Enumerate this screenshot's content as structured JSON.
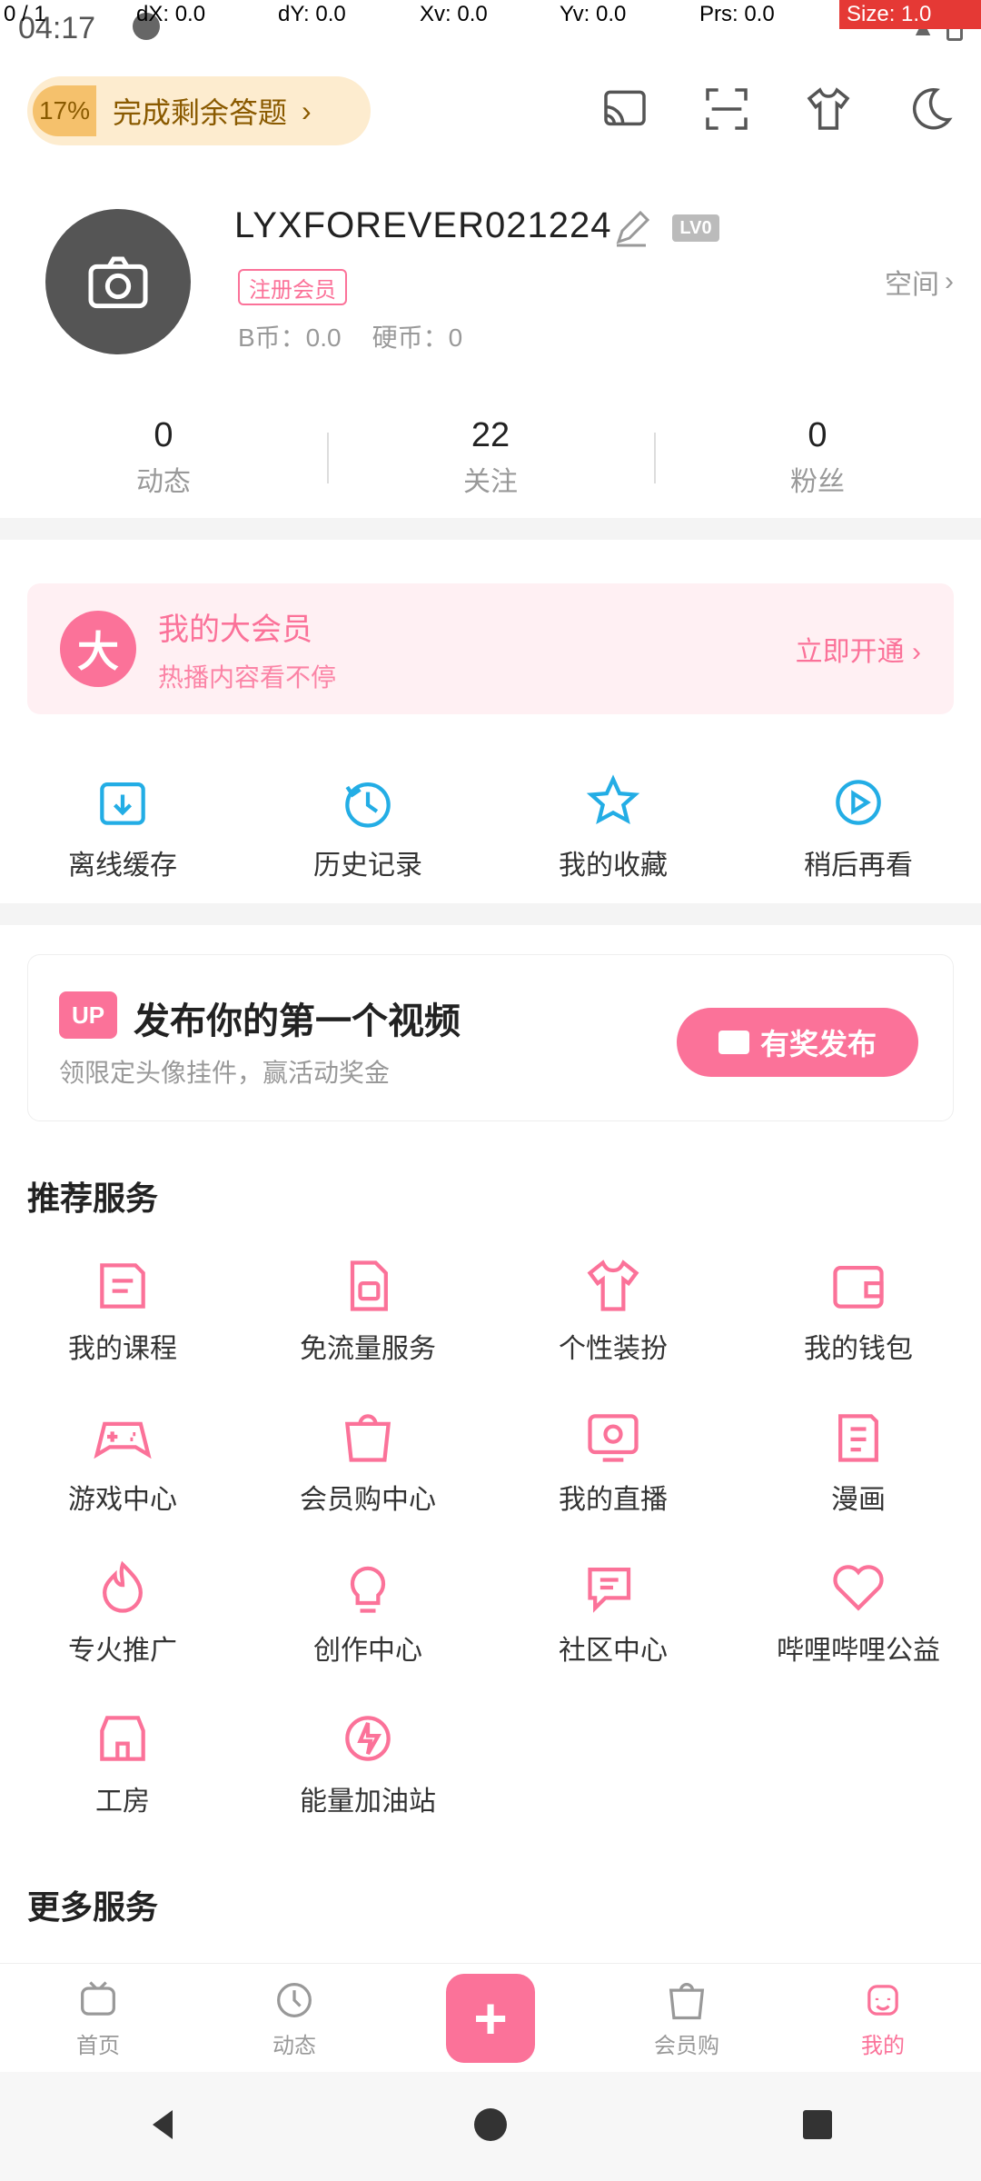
{
  "statusbar": {
    "time": "04:17"
  },
  "debug": {
    "p": "0 / 1",
    "dx": "dX: 0.0",
    "dy": "dY: 0.0",
    "xv": "Xv: 0.0",
    "yv": "Yv: 0.0",
    "prs": "Prs: 0.0",
    "size": "Size: 1.0"
  },
  "topbar": {
    "percent": "17%",
    "answers_text": "完成剩余答题",
    "answers_arrow": "›",
    "icons": [
      "cast-icon",
      "scan-icon",
      "tshirt-icon",
      "moon-icon"
    ]
  },
  "profile": {
    "username": "LYXFOREVER021224",
    "lv": "LV0",
    "register_tag": "注册会员",
    "space_link": "空间",
    "bcoin": "B币：0.0",
    "coin": "硬币：0"
  },
  "stats": [
    {
      "num": "0",
      "label": "动态"
    },
    {
      "num": "22",
      "label": "关注"
    },
    {
      "num": "0",
      "label": "粉丝"
    }
  ],
  "vip": {
    "badge": "大",
    "title": "我的大会员",
    "subtitle": "热播内容看不停",
    "open": "立即开通",
    "open_arrow": "›"
  },
  "quick": [
    {
      "label": "离线缓存",
      "icon": "download-icon"
    },
    {
      "label": "历史记录",
      "icon": "history-icon"
    },
    {
      "label": "我的收藏",
      "icon": "star-icon"
    },
    {
      "label": "稍后再看",
      "icon": "watch-later-icon"
    }
  ],
  "upload": {
    "badge": "UP",
    "title": "发布你的第一个视频",
    "subtitle": "领限定头像挂件，赢活动奖金",
    "button": "有奖发布"
  },
  "recommend": {
    "title": "推荐服务",
    "rows": [
      [
        {
          "label": "我的课程",
          "icon": "course-icon"
        },
        {
          "label": "免流量服务",
          "icon": "sim-icon"
        },
        {
          "label": "个性装扮",
          "icon": "tshirt-icon"
        },
        {
          "label": "我的钱包",
          "icon": "wallet-icon"
        }
      ],
      [
        {
          "label": "游戏中心",
          "icon": "gamepad-icon"
        },
        {
          "label": "会员购中心",
          "icon": "shopping-bag-icon"
        },
        {
          "label": "我的直播",
          "icon": "live-icon"
        },
        {
          "label": "漫画",
          "icon": "comic-icon"
        }
      ],
      [
        {
          "label": "专火推广",
          "icon": "flame-icon"
        },
        {
          "label": "创作中心",
          "icon": "bulb-icon"
        },
        {
          "label": "社区中心",
          "icon": "chat-icon"
        },
        {
          "label": "哔哩哔哩公益",
          "icon": "heart-icon"
        }
      ],
      [
        {
          "label": "工房",
          "icon": "shop-icon"
        },
        {
          "label": "能量加油站",
          "icon": "energy-icon"
        }
      ]
    ]
  },
  "more": {
    "title": "更多服务"
  },
  "tabbar": {
    "items": [
      {
        "label": "首页",
        "icon": "home-icon"
      },
      {
        "label": "动态",
        "icon": "dynamic-icon"
      },
      {
        "label": "",
        "icon": "add-icon"
      },
      {
        "label": "会员购",
        "icon": "shopping-bag-icon"
      },
      {
        "label": "我的",
        "icon": "me-icon"
      }
    ]
  },
  "colors": {
    "accent": "#fb7299",
    "gold": "#f5c16c"
  }
}
